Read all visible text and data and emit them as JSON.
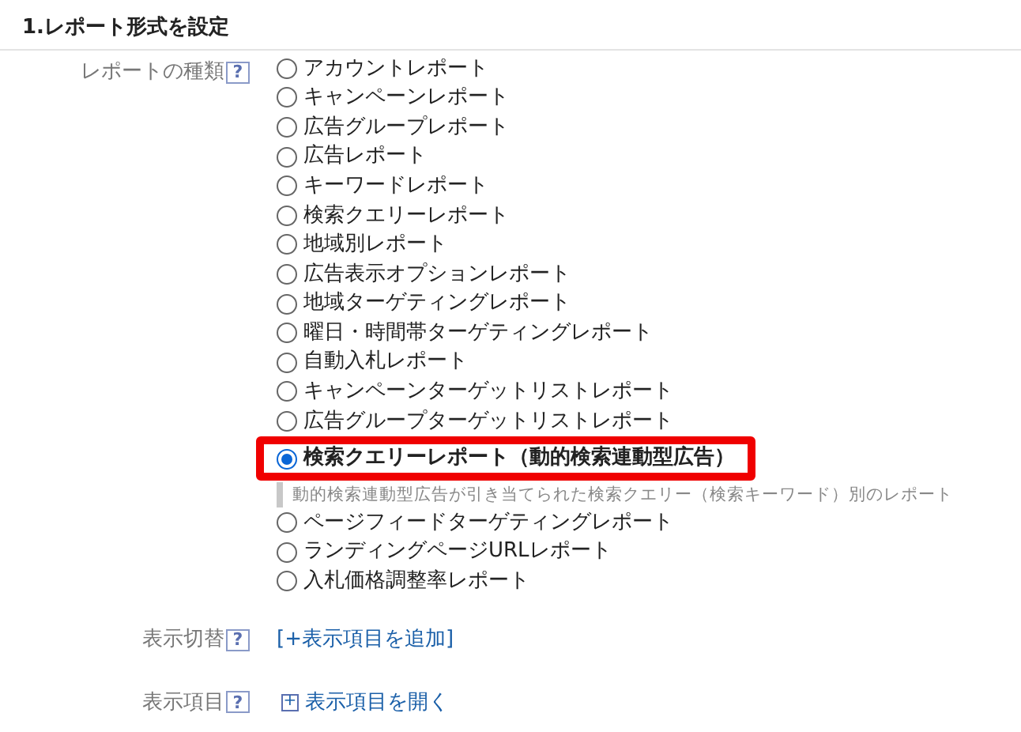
{
  "section_title": "1.レポート形式を設定",
  "report_type": {
    "label": "レポートの種類",
    "help": "?",
    "options": [
      {
        "label": "アカウントレポート",
        "selected": false
      },
      {
        "label": "キャンペーンレポート",
        "selected": false
      },
      {
        "label": "広告グループレポート",
        "selected": false
      },
      {
        "label": "広告レポート",
        "selected": false
      },
      {
        "label": "キーワードレポート",
        "selected": false
      },
      {
        "label": "検索クエリーレポート",
        "selected": false
      },
      {
        "label": "地域別レポート",
        "selected": false
      },
      {
        "label": "広告表示オプションレポート",
        "selected": false
      },
      {
        "label": "地域ターゲティングレポート",
        "selected": false
      },
      {
        "label": "曜日・時間帯ターゲティングレポート",
        "selected": false
      },
      {
        "label": "自動入札レポート",
        "selected": false
      },
      {
        "label": "キャンペーンターゲットリストレポート",
        "selected": false
      },
      {
        "label": "広告グループターゲットリストレポート",
        "selected": false
      },
      {
        "label": "検索クエリーレポート（動的検索連動型広告）",
        "selected": true,
        "highlighted": true,
        "description": "動的検索連動型広告が引き当てられた検索クエリー（検索キーワード）別のレポート"
      },
      {
        "label": "ページフィードターゲティングレポート",
        "selected": false
      },
      {
        "label": "ランディングページURLレポート",
        "selected": false
      },
      {
        "label": "入札価格調整率レポート",
        "selected": false
      }
    ]
  },
  "display_toggle": {
    "label": "表示切替",
    "help": "?",
    "link": "[+表示項目を追加]"
  },
  "display_items": {
    "label": "表示項目",
    "help": "?",
    "toggle": "+",
    "link": "表示項目を開く"
  }
}
